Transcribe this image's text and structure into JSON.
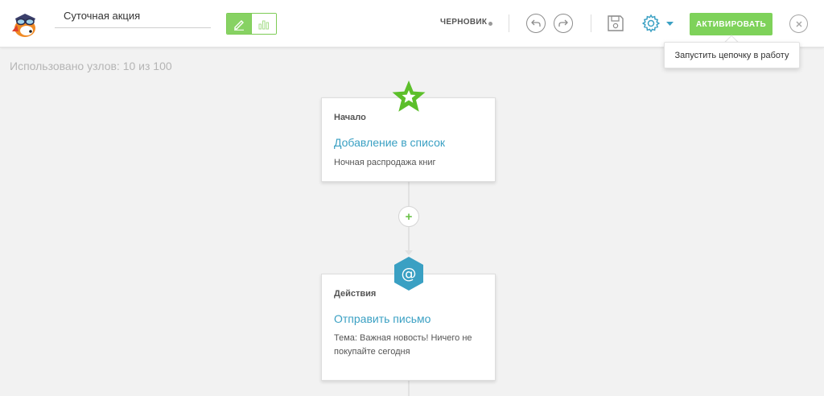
{
  "header": {
    "chain_name": "Суточная акция",
    "status": "ЧЕРНОВИК",
    "activate_label": "АКТИВИРОВАТЬ",
    "tooltip": "Запустить цепочку в работу",
    "icons": {
      "logo": "fox-aviator-logo",
      "edit": "pencil-icon",
      "stats": "bar-chart-icon",
      "undo": "undo-icon",
      "redo": "redo-icon",
      "save": "save-icon",
      "settings": "gear-icon",
      "settings_menu": "caret-down-icon",
      "close": "close-icon"
    }
  },
  "usage": "Использовано узлов: 10 из 100",
  "nodes": [
    {
      "type": "Начало",
      "title": "Добавление в список",
      "desc": "Ночная распродажа книг",
      "icon": "star-icon",
      "icon_color": "#5cbf2a"
    },
    {
      "type": "Действия",
      "title": "Отправить письмо",
      "desc": "Тема: Важная новость! Ничего не покупайте сегодня",
      "icon": "email-at-icon",
      "icon_color": "#3aa0c3"
    }
  ],
  "add_node_symbol": "+",
  "colors": {
    "accent_green": "#7ed25a",
    "link_blue": "#3aa0c3",
    "settings_blue": "#3aa0c3"
  }
}
